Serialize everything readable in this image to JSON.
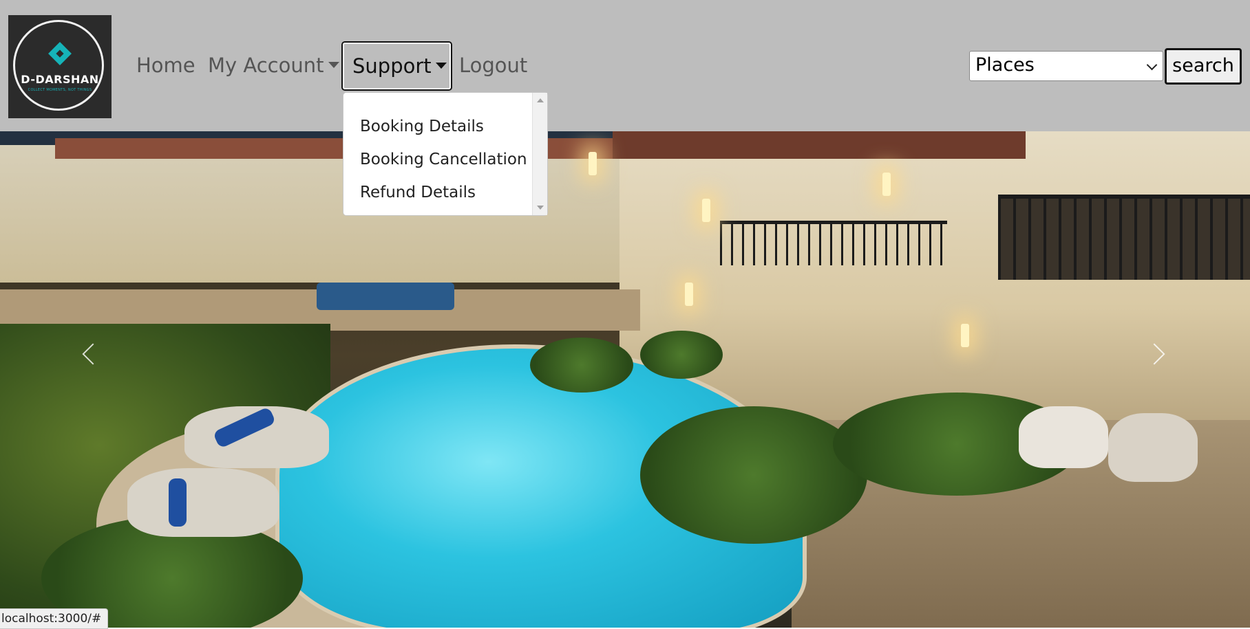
{
  "brand": {
    "name": "D-DARSHAN",
    "tagline": "COLLECT MOMENTS, NOT THINGS",
    "accent_color": "#16b3b8"
  },
  "nav": {
    "home": "Home",
    "my_account": "My Account",
    "support": "Support",
    "logout": "Logout"
  },
  "support_menu": {
    "items": [
      {
        "label": "Booking Details"
      },
      {
        "label": "Booking Cancellation"
      },
      {
        "label": "Refund Details"
      }
    ]
  },
  "search": {
    "select_value": "Places",
    "button_label": "search"
  },
  "carousel": {
    "prev_icon": "chevron-left-icon",
    "next_icon": "chevron-right-icon"
  },
  "status_bar": {
    "url": "localhost:3000/#"
  },
  "colors": {
    "navbar_bg": "#bdbdbd"
  }
}
